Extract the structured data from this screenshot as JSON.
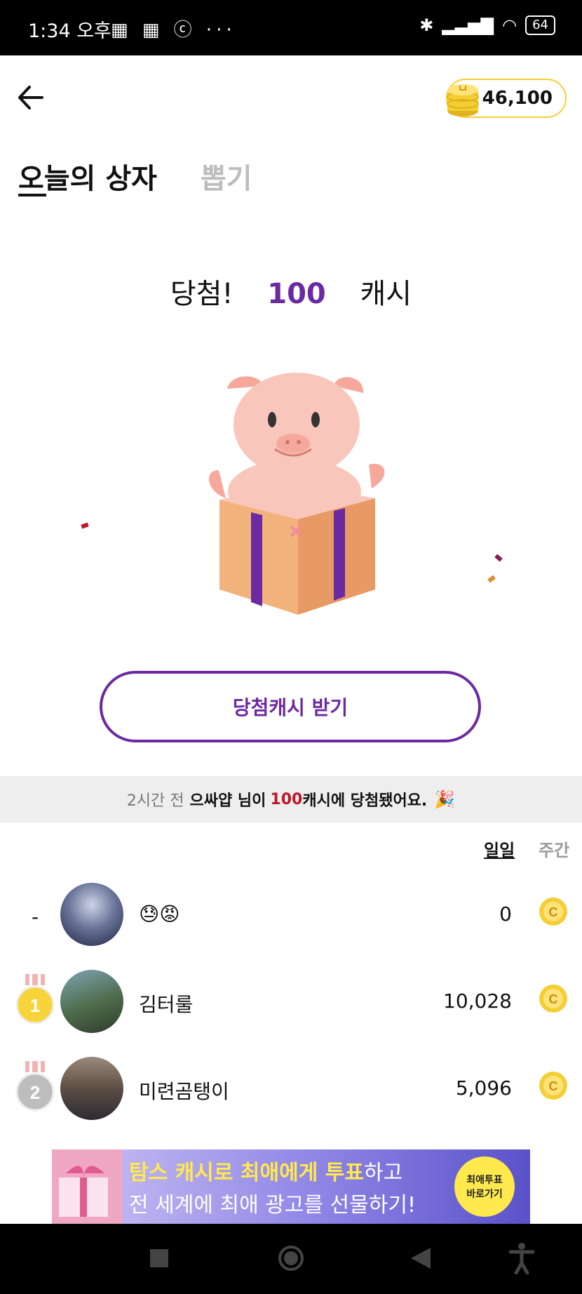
{
  "status_bar": {
    "time": "1:34 오후",
    "icons": [
      "notification-icon",
      "notification-icon",
      "app-icon",
      "more-icon"
    ],
    "battery": "64"
  },
  "header": {
    "coin_balance": "46,100"
  },
  "tabs": [
    {
      "label": "오늘의 상자",
      "active": true
    },
    {
      "label": "뽑기",
      "active": false
    }
  ],
  "result": {
    "prefix": "당첨!",
    "amount": "100",
    "unit": "캐시"
  },
  "claim_button": "당첨캐시 받기",
  "notice": {
    "time": "2시간 전",
    "user": "으싸얍 님이",
    "amount": "100",
    "suffix": "캐시에 당첨됐어요."
  },
  "period_tabs": {
    "daily": "일일",
    "weekly": "주간"
  },
  "ranking": [
    {
      "rank": "-",
      "name": "😓😡",
      "score": "0"
    },
    {
      "rank": "1",
      "name": "김터룰",
      "score": "10,028"
    },
    {
      "rank": "2",
      "name": "미련곰탱이",
      "score": "5,096"
    }
  ],
  "banner": {
    "line1_highlight": "탐스 캐시로 최애에게 투표",
    "line1_rest": "하고",
    "line2": "전 세계에 최애 광고를 선물하기!",
    "cta_line1": "최애투표",
    "cta_line2": "바로가기"
  },
  "colors": {
    "accent": "#6b2aa1",
    "coin": "#f4cf34",
    "highlight_red": "#c0182a"
  }
}
